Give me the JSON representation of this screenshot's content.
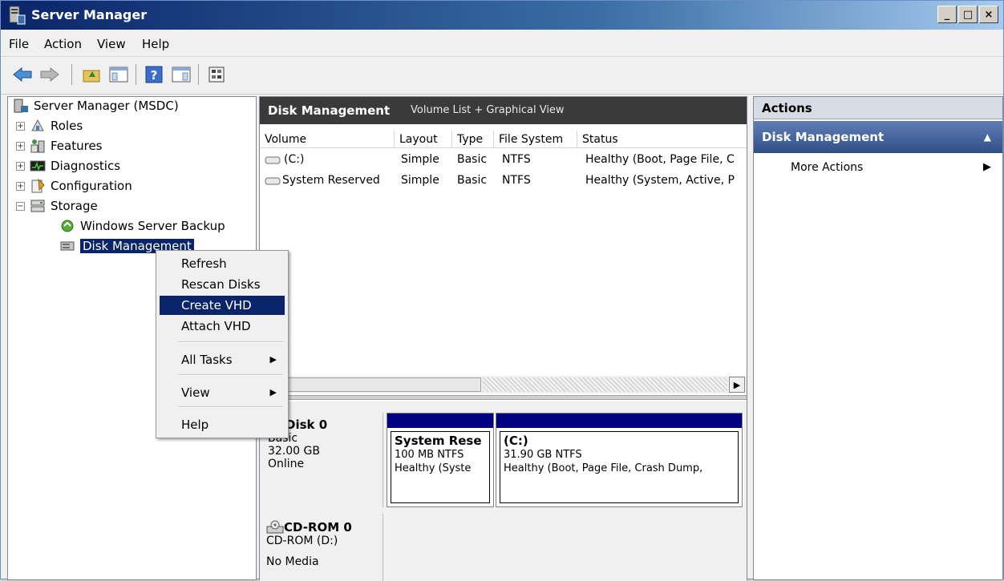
{
  "window": {
    "title": "Server Manager",
    "buttons": {
      "minimize": "_",
      "maximize": "□",
      "close": "×"
    }
  },
  "menubar": {
    "items": [
      "File",
      "Action",
      "View",
      "Help"
    ]
  },
  "toolbar": {
    "buttons": [
      "back-icon",
      "forward-icon",
      "up-folder-icon",
      "show-hide-tree-icon",
      "help-icon",
      "show-hide-action-pane-icon",
      "properties-icon"
    ]
  },
  "tree": {
    "root": "Server Manager (MSDC)",
    "nodes": [
      {
        "label": "Roles",
        "expander": "+"
      },
      {
        "label": "Features",
        "expander": "+"
      },
      {
        "label": "Diagnostics",
        "expander": "+"
      },
      {
        "label": "Configuration",
        "expander": "+"
      },
      {
        "label": "Storage",
        "expander": "−"
      },
      {
        "label": "Windows Server Backup"
      },
      {
        "label": "Disk Management",
        "selected": true
      }
    ]
  },
  "context_menu": {
    "items": [
      {
        "label": "Refresh"
      },
      {
        "label": "Rescan Disks"
      },
      {
        "label": "Create VHD",
        "highlighted": true
      },
      {
        "label": "Attach VHD"
      },
      {
        "label": "All Tasks",
        "submenu": "▶"
      },
      {
        "label": "View",
        "submenu": "▶"
      },
      {
        "label": "Help"
      }
    ]
  },
  "center": {
    "title": "Disk Management",
    "subtitle": "Volume List + Graphical View",
    "columns": [
      "Volume",
      "Layout",
      "Type",
      "File System",
      "Status"
    ],
    "rows": [
      {
        "volume": "(C:)",
        "layout": "Simple",
        "type": "Basic",
        "fs": "NTFS",
        "status": "Healthy (Boot, Page File, C"
      },
      {
        "volume": "System Reserved",
        "layout": "Simple",
        "type": "Basic",
        "fs": "NTFS",
        "status": "Healthy (System, Active, P"
      }
    ],
    "disk0": {
      "name": "Disk 0",
      "type": "Basic",
      "size": "32.00 GB",
      "state": "Online",
      "partitions": [
        {
          "name": "System Rese",
          "size": "100 MB NTFS",
          "status": "Healthy (Syste"
        },
        {
          "name": "(C:)",
          "size": "31.90 GB NTFS",
          "status": "Healthy (Boot, Page File, Crash Dump,"
        }
      ]
    },
    "cdrom0": {
      "name": "CD-ROM 0",
      "drive": "CD-ROM (D:)",
      "media": "No Media"
    }
  },
  "actions": {
    "header": "Actions",
    "section": "Disk Management",
    "item": "More Actions",
    "section_caret": "▲",
    "item_arrow": "▶"
  },
  "colors": {
    "selection": "#0a246a",
    "title_gradient_start": "#0a246a",
    "partition_bar": "#000080",
    "actions_section": "#2e4e86"
  }
}
